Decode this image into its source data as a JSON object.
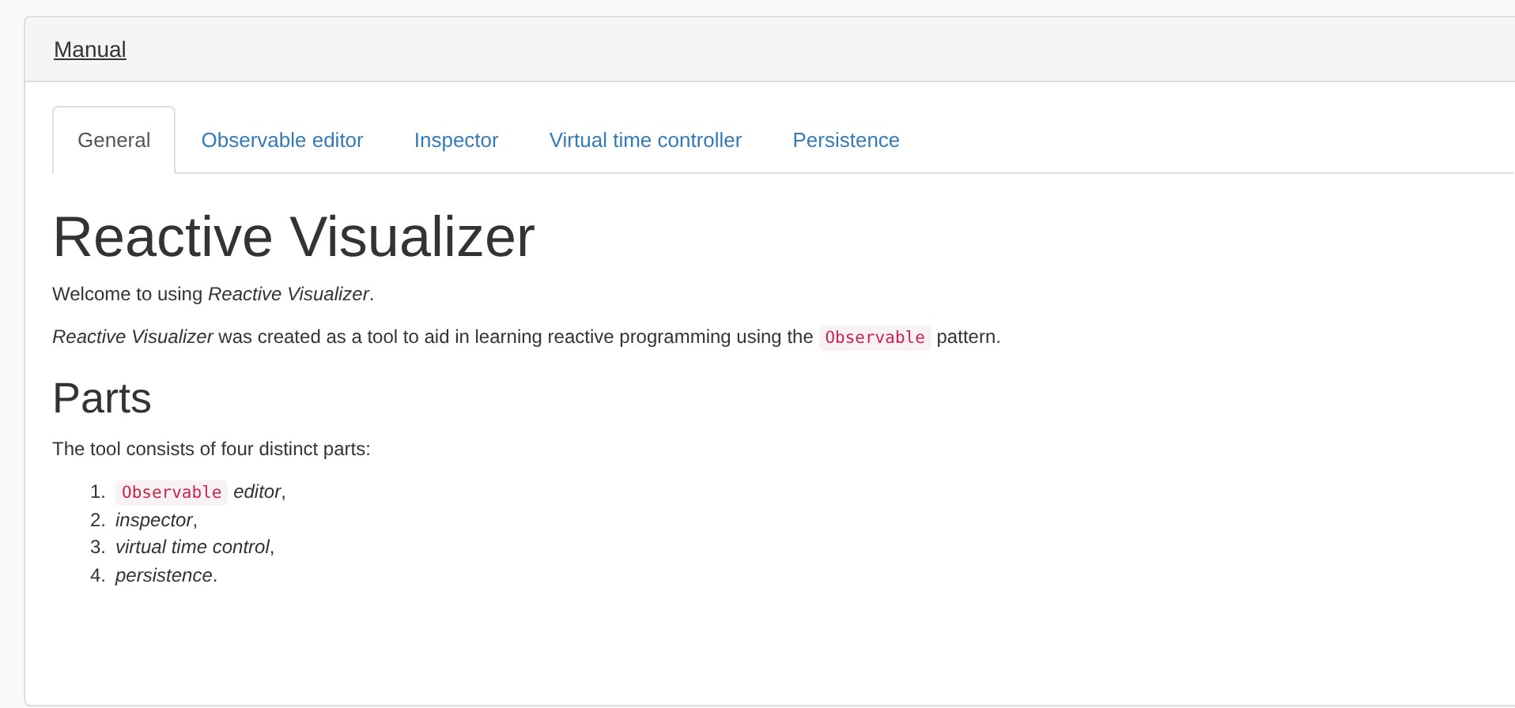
{
  "panel": {
    "title": "Manual"
  },
  "tabs": [
    {
      "label": "General",
      "selected": true
    },
    {
      "label": "Observable editor",
      "selected": false
    },
    {
      "label": "Inspector",
      "selected": false
    },
    {
      "label": "Virtual time controller",
      "selected": false
    },
    {
      "label": "Persistence",
      "selected": false
    }
  ],
  "content": [
    {
      "kind": "h1",
      "parts": [
        {
          "kind": "text",
          "text": "Reactive Visualizer"
        }
      ]
    },
    {
      "kind": "p",
      "parts": [
        {
          "kind": "text",
          "text": "Welcome to using *Reactive Visualizer*."
        }
      ]
    },
    {
      "kind": "p",
      "parts": [
        {
          "kind": "text",
          "text": "*Reactive Visualizer* was created as a tool to aid in learning reactive programming using the "
        },
        {
          "kind": "code",
          "text": "Observable"
        },
        {
          "kind": "text",
          "text": " pattern."
        }
      ]
    },
    {
      "kind": "h2",
      "parts": [
        {
          "kind": "text",
          "text": "Parts"
        }
      ]
    },
    {
      "kind": "p",
      "parts": [
        {
          "kind": "text",
          "text": "The tool consists of four distinct parts:"
        }
      ]
    }
  ],
  "list": [
    {
      "number": "1.",
      "parts": [
        {
          "kind": "code",
          "text": "Observable"
        },
        {
          "kind": "text",
          "text": " *editor*,"
        }
      ]
    },
    {
      "number": "2.",
      "parts": [
        {
          "kind": "text",
          "text": "*inspector*,"
        }
      ]
    },
    {
      "number": "3.",
      "parts": [
        {
          "kind": "text",
          "text": "*virtual time control*,"
        }
      ]
    },
    {
      "number": "4.",
      "parts": [
        {
          "kind": "text",
          "text": "*persistence*."
        }
      ]
    }
  ]
}
